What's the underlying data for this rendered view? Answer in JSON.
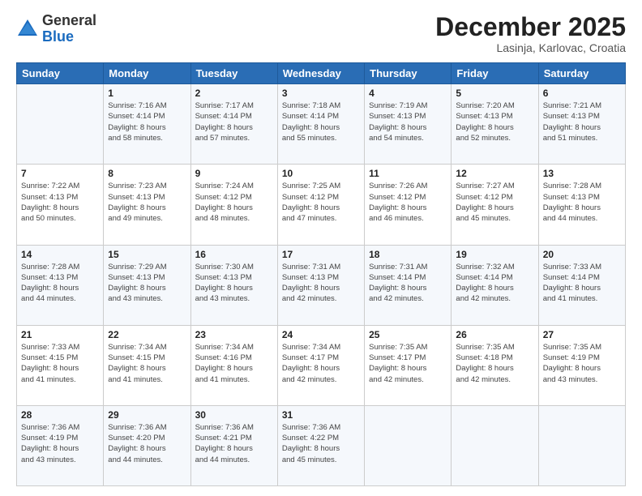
{
  "header": {
    "logo_line1": "General",
    "logo_line2": "Blue",
    "month": "December 2025",
    "location": "Lasinja, Karlovac, Croatia"
  },
  "weekdays": [
    "Sunday",
    "Monday",
    "Tuesday",
    "Wednesday",
    "Thursday",
    "Friday",
    "Saturday"
  ],
  "weeks": [
    [
      {
        "day": "",
        "info": ""
      },
      {
        "day": "1",
        "info": "Sunrise: 7:16 AM\nSunset: 4:14 PM\nDaylight: 8 hours\nand 58 minutes."
      },
      {
        "day": "2",
        "info": "Sunrise: 7:17 AM\nSunset: 4:14 PM\nDaylight: 8 hours\nand 57 minutes."
      },
      {
        "day": "3",
        "info": "Sunrise: 7:18 AM\nSunset: 4:14 PM\nDaylight: 8 hours\nand 55 minutes."
      },
      {
        "day": "4",
        "info": "Sunrise: 7:19 AM\nSunset: 4:13 PM\nDaylight: 8 hours\nand 54 minutes."
      },
      {
        "day": "5",
        "info": "Sunrise: 7:20 AM\nSunset: 4:13 PM\nDaylight: 8 hours\nand 52 minutes."
      },
      {
        "day": "6",
        "info": "Sunrise: 7:21 AM\nSunset: 4:13 PM\nDaylight: 8 hours\nand 51 minutes."
      }
    ],
    [
      {
        "day": "7",
        "info": "Sunrise: 7:22 AM\nSunset: 4:13 PM\nDaylight: 8 hours\nand 50 minutes."
      },
      {
        "day": "8",
        "info": "Sunrise: 7:23 AM\nSunset: 4:13 PM\nDaylight: 8 hours\nand 49 minutes."
      },
      {
        "day": "9",
        "info": "Sunrise: 7:24 AM\nSunset: 4:12 PM\nDaylight: 8 hours\nand 48 minutes."
      },
      {
        "day": "10",
        "info": "Sunrise: 7:25 AM\nSunset: 4:12 PM\nDaylight: 8 hours\nand 47 minutes."
      },
      {
        "day": "11",
        "info": "Sunrise: 7:26 AM\nSunset: 4:12 PM\nDaylight: 8 hours\nand 46 minutes."
      },
      {
        "day": "12",
        "info": "Sunrise: 7:27 AM\nSunset: 4:12 PM\nDaylight: 8 hours\nand 45 minutes."
      },
      {
        "day": "13",
        "info": "Sunrise: 7:28 AM\nSunset: 4:13 PM\nDaylight: 8 hours\nand 44 minutes."
      }
    ],
    [
      {
        "day": "14",
        "info": "Sunrise: 7:28 AM\nSunset: 4:13 PM\nDaylight: 8 hours\nand 44 minutes."
      },
      {
        "day": "15",
        "info": "Sunrise: 7:29 AM\nSunset: 4:13 PM\nDaylight: 8 hours\nand 43 minutes."
      },
      {
        "day": "16",
        "info": "Sunrise: 7:30 AM\nSunset: 4:13 PM\nDaylight: 8 hours\nand 43 minutes."
      },
      {
        "day": "17",
        "info": "Sunrise: 7:31 AM\nSunset: 4:13 PM\nDaylight: 8 hours\nand 42 minutes."
      },
      {
        "day": "18",
        "info": "Sunrise: 7:31 AM\nSunset: 4:14 PM\nDaylight: 8 hours\nand 42 minutes."
      },
      {
        "day": "19",
        "info": "Sunrise: 7:32 AM\nSunset: 4:14 PM\nDaylight: 8 hours\nand 42 minutes."
      },
      {
        "day": "20",
        "info": "Sunrise: 7:33 AM\nSunset: 4:14 PM\nDaylight: 8 hours\nand 41 minutes."
      }
    ],
    [
      {
        "day": "21",
        "info": "Sunrise: 7:33 AM\nSunset: 4:15 PM\nDaylight: 8 hours\nand 41 minutes."
      },
      {
        "day": "22",
        "info": "Sunrise: 7:34 AM\nSunset: 4:15 PM\nDaylight: 8 hours\nand 41 minutes."
      },
      {
        "day": "23",
        "info": "Sunrise: 7:34 AM\nSunset: 4:16 PM\nDaylight: 8 hours\nand 41 minutes."
      },
      {
        "day": "24",
        "info": "Sunrise: 7:34 AM\nSunset: 4:17 PM\nDaylight: 8 hours\nand 42 minutes."
      },
      {
        "day": "25",
        "info": "Sunrise: 7:35 AM\nSunset: 4:17 PM\nDaylight: 8 hours\nand 42 minutes."
      },
      {
        "day": "26",
        "info": "Sunrise: 7:35 AM\nSunset: 4:18 PM\nDaylight: 8 hours\nand 42 minutes."
      },
      {
        "day": "27",
        "info": "Sunrise: 7:35 AM\nSunset: 4:19 PM\nDaylight: 8 hours\nand 43 minutes."
      }
    ],
    [
      {
        "day": "28",
        "info": "Sunrise: 7:36 AM\nSunset: 4:19 PM\nDaylight: 8 hours\nand 43 minutes."
      },
      {
        "day": "29",
        "info": "Sunrise: 7:36 AM\nSunset: 4:20 PM\nDaylight: 8 hours\nand 44 minutes."
      },
      {
        "day": "30",
        "info": "Sunrise: 7:36 AM\nSunset: 4:21 PM\nDaylight: 8 hours\nand 44 minutes."
      },
      {
        "day": "31",
        "info": "Sunrise: 7:36 AM\nSunset: 4:22 PM\nDaylight: 8 hours\nand 45 minutes."
      },
      {
        "day": "",
        "info": ""
      },
      {
        "day": "",
        "info": ""
      },
      {
        "day": "",
        "info": ""
      }
    ]
  ]
}
